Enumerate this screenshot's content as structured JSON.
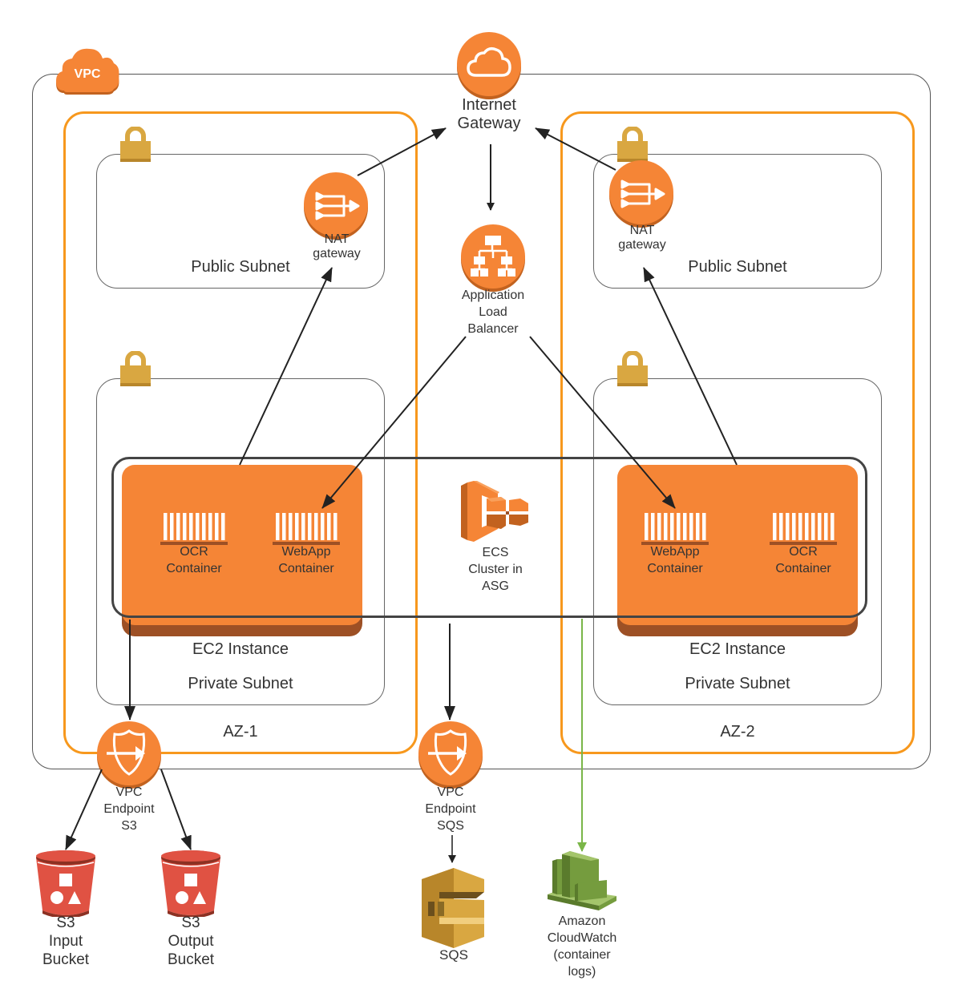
{
  "vpc": {
    "badge": "VPC"
  },
  "internet_gateway": {
    "line1": "Internet",
    "line2": "Gateway"
  },
  "availability_zones": [
    {
      "label": "AZ-1"
    },
    {
      "label": "AZ-2"
    }
  ],
  "public_subnets": [
    {
      "label": "Public Subnet",
      "nat": {
        "line1": "NAT",
        "line2": "gateway"
      }
    },
    {
      "label": "Public Subnet",
      "nat": {
        "line1": "NAT",
        "line2": "gateway"
      }
    }
  ],
  "private_subnets": [
    {
      "label": "Private Subnet",
      "ec2_label": "EC2 Instance",
      "containers": [
        {
          "line1": "OCR",
          "line2": "Container"
        },
        {
          "line1": "WebApp",
          "line2": "Container"
        }
      ]
    },
    {
      "label": "Private Subnet",
      "ec2_label": "EC2 Instance",
      "containers": [
        {
          "line1": "WebApp",
          "line2": "Container"
        },
        {
          "line1": "OCR",
          "line2": "Container"
        }
      ]
    }
  ],
  "load_balancer": {
    "line1": "Application",
    "line2": "Load",
    "line3": "Balancer"
  },
  "ecs": {
    "line1": "ECS",
    "line2": "Cluster in",
    "line3": "ASG"
  },
  "vpc_endpoint_s3": {
    "line1": "VPC",
    "line2": "Endpoint",
    "line3": "S3"
  },
  "vpc_endpoint_sqs": {
    "line1": "VPC",
    "line2": "Endpoint",
    "line3": "SQS"
  },
  "s3_input": {
    "line1": "S3",
    "line2": "Input",
    "line3": "Bucket"
  },
  "s3_output": {
    "line1": "S3",
    "line2": "Output",
    "line3": "Bucket"
  },
  "sqs": {
    "label": "SQS"
  },
  "cloudwatch": {
    "line1": "Amazon",
    "line2": "CloudWatch",
    "line3": "(container",
    "line4": "logs)"
  },
  "colors": {
    "aws_orange": "#F58536",
    "az_border": "#F7981D",
    "lock_gold": "#D9A741",
    "s3_red": "#E05243",
    "sqs_gold": "#D9A741",
    "cloudwatch_green": "#759C3E",
    "arrow": "#222222",
    "log_line": "#7AB648"
  }
}
